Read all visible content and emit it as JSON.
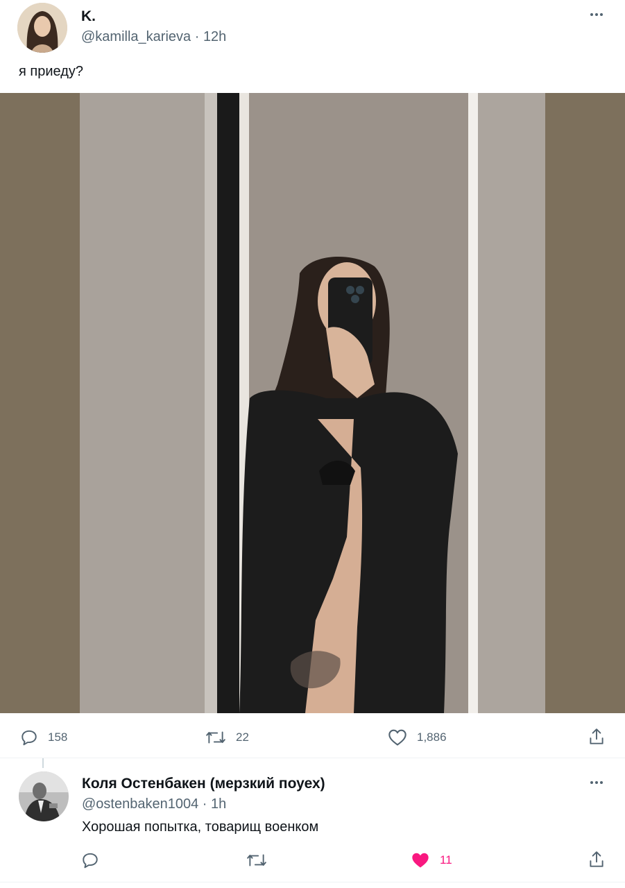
{
  "tweet": {
    "display_name": "K.",
    "handle": "@kamilla_karieva",
    "time": "12h",
    "text": "я приеду?",
    "media_description": "",
    "stats": {
      "replies": "158",
      "retweets": "22",
      "likes": "1,886"
    }
  },
  "reply": {
    "display_name": "Коля Остенбакен (мерзкий поуех)",
    "handle": "@ostenbaken1004",
    "time": "1h",
    "text": "Хорошая попытка, товарищ военком",
    "stats": {
      "likes": "11"
    }
  },
  "separator": "·",
  "icons": {
    "reply": "reply-icon",
    "retweet": "retweet-icon",
    "like": "heart-icon",
    "share": "share-icon",
    "more": "more-icon"
  },
  "colors": {
    "text": "#0f1419",
    "muted": "#536471",
    "like_active": "#f91880",
    "wall": "#7d705c"
  }
}
